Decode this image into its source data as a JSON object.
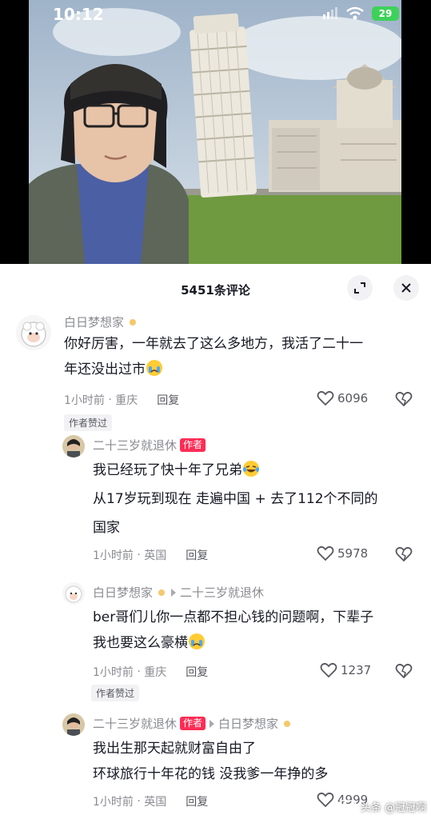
{
  "status_bar": {
    "time": "10:12",
    "battery": "29"
  },
  "sheet": {
    "title": "5451条评论"
  },
  "comments": [
    {
      "user": "白日梦想家",
      "lines": [
        "你好厉害，一年就去了这么多地方，我活了二十一",
        "年还没出过市"
      ],
      "time": "1小时前",
      "location": "重庆",
      "reply_label": "回复",
      "likes": "6096",
      "badge": "作者赞过"
    },
    {
      "user": "二十三岁就退休",
      "author_tag": "作者",
      "lines": [
        "我已经玩了快十年了兄弟",
        "从17岁玩到现在  走遍中国 + 去了112个不同的",
        "国家"
      ],
      "time": "1小时前",
      "location": "英国",
      "reply_label": "回复",
      "likes": "5978"
    },
    {
      "user": "白日梦想家",
      "reply_to": "二十三岁就退休",
      "lines": [
        "ber哥们儿你一点都不担心钱的问题啊，下辈子",
        "我也要这么豪横"
      ],
      "time": "1小时前",
      "location": "重庆",
      "reply_label": "回复",
      "likes": "1237",
      "badge": "作者赞过"
    },
    {
      "user": "二十三岁就退休",
      "author_tag": "作者",
      "reply_to": "白日梦想家",
      "lines": [
        "我出生那天起就财富自由了",
        "环球旅行十年花的钱 没我爹一年挣的多"
      ],
      "time": "1小时前",
      "location": "英国",
      "reply_label": "回复",
      "likes": "4999"
    }
  ],
  "watermark": {
    "text": "头条 @冠冠啊"
  },
  "icons": {
    "expand": "expand-icon",
    "close": "close-icon",
    "like": "heart-outline-icon",
    "dislike": "broken-heart-icon",
    "emoji_cry": "crying-emoji-icon",
    "emoji_laugh": "laugh-tears-emoji-icon"
  },
  "colors": {
    "author_tag": "#fe2c55",
    "battery": "#3ed15a",
    "meta": "#8a8b91"
  }
}
